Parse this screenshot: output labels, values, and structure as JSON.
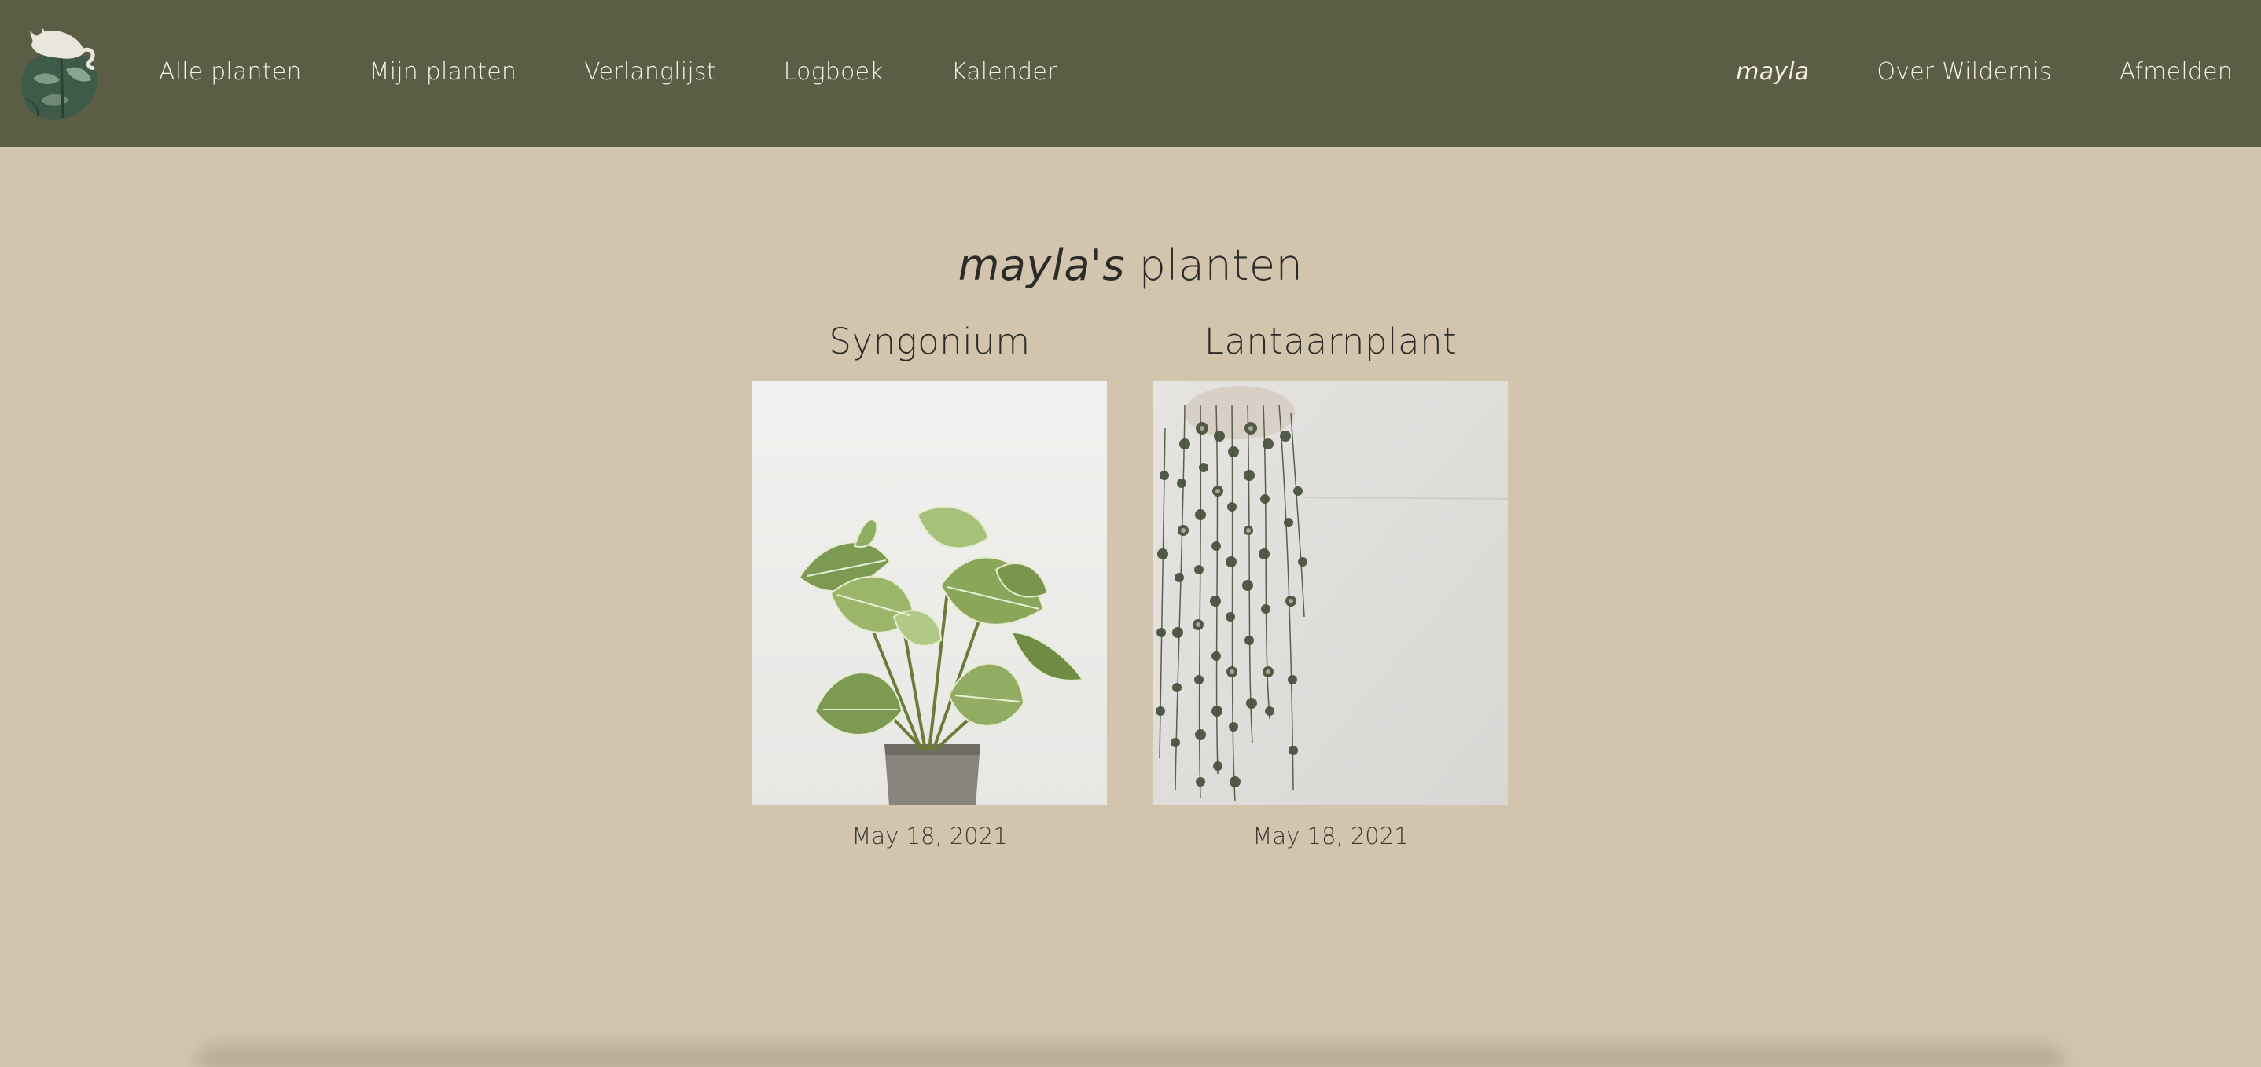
{
  "colors": {
    "navbar_bg": "#5b5d44",
    "page_bg": "#d3c4ae",
    "nav_text": "#f4f1e8",
    "text_dark": "#2b2b28"
  },
  "nav": {
    "logo_icon": "monstera-leaf-cat-logo",
    "left": [
      {
        "label": "Alle planten"
      },
      {
        "label": "Mijn planten"
      },
      {
        "label": "Verlanglijst"
      },
      {
        "label": "Logboek"
      },
      {
        "label": "Kalender"
      }
    ],
    "right": {
      "user": "mayla",
      "about": "Over Wildernis",
      "logout": "Afmelden"
    }
  },
  "page": {
    "owner": "mayla's",
    "title_suffix": "planten"
  },
  "plants": [
    {
      "name": "Syngonium",
      "date": "May 18, 2021",
      "image": "syngonium-photo"
    },
    {
      "name": "Lantaarnplant",
      "date": "May 18, 2021",
      "image": "string-of-hearts-photo"
    }
  ]
}
